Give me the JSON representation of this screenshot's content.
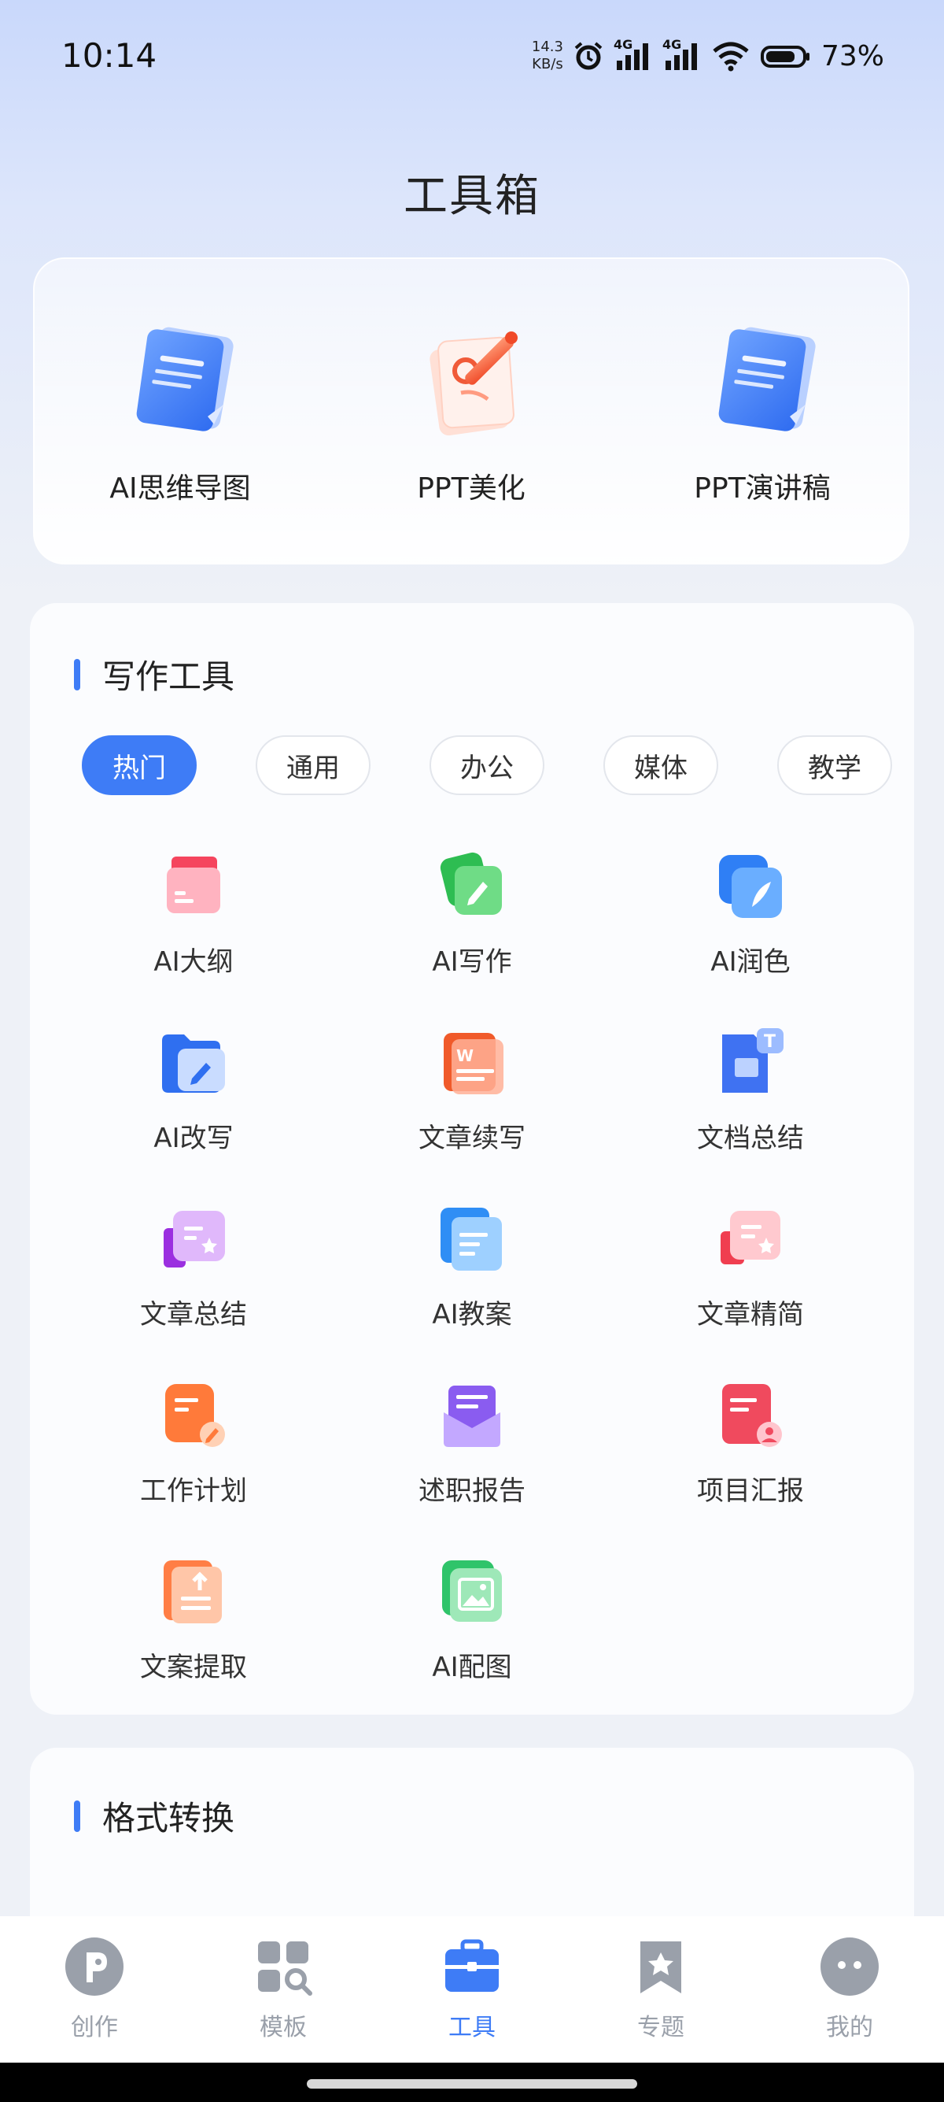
{
  "status_bar": {
    "time": "10:14",
    "speed_value": "14.3",
    "speed_unit": "KB/s",
    "network_1": "4G",
    "network_2": "4G",
    "battery": "73%"
  },
  "page_title": "工具箱",
  "feature_tools": [
    {
      "label": "AI思维导图",
      "icon": "mindmap-doc-icon"
    },
    {
      "label": "PPT美化",
      "icon": "ppt-beautify-icon"
    },
    {
      "label": "PPT演讲稿",
      "icon": "ppt-speech-icon"
    }
  ],
  "writing_section": {
    "title": "写作工具",
    "tabs": [
      "热门",
      "通用",
      "办公",
      "媒体",
      "教学"
    ],
    "active_tab": "热门",
    "tools": [
      {
        "label": "AI大纲",
        "icon": "outline-icon"
      },
      {
        "label": "AI写作",
        "icon": "writing-icon"
      },
      {
        "label": "AI润色",
        "icon": "polish-icon"
      },
      {
        "label": "AI改写",
        "icon": "rewrite-icon"
      },
      {
        "label": "文章续写",
        "icon": "continue-writing-icon"
      },
      {
        "label": "文档总结",
        "icon": "doc-summary-icon"
      },
      {
        "label": "文章总结",
        "icon": "article-summary-icon"
      },
      {
        "label": "AI教案",
        "icon": "lesson-plan-icon"
      },
      {
        "label": "文章精简",
        "icon": "article-simplify-icon"
      },
      {
        "label": "工作计划",
        "icon": "work-plan-icon"
      },
      {
        "label": "述职报告",
        "icon": "report-icon"
      },
      {
        "label": "项目汇报",
        "icon": "project-report-icon"
      },
      {
        "label": "文案提取",
        "icon": "text-extract-icon"
      },
      {
        "label": "AI配图",
        "icon": "image-gen-icon"
      }
    ]
  },
  "format_section": {
    "title": "格式转换"
  },
  "bottom_nav": [
    {
      "label": "创作",
      "icon": "create-icon"
    },
    {
      "label": "模板",
      "icon": "template-icon"
    },
    {
      "label": "工具",
      "icon": "toolbox-icon"
    },
    {
      "label": "专题",
      "icon": "topic-icon"
    },
    {
      "label": "我的",
      "icon": "profile-icon"
    }
  ],
  "colors": {
    "accent": "#3e7cf6",
    "nav_inactive": "#9aa0aa"
  }
}
